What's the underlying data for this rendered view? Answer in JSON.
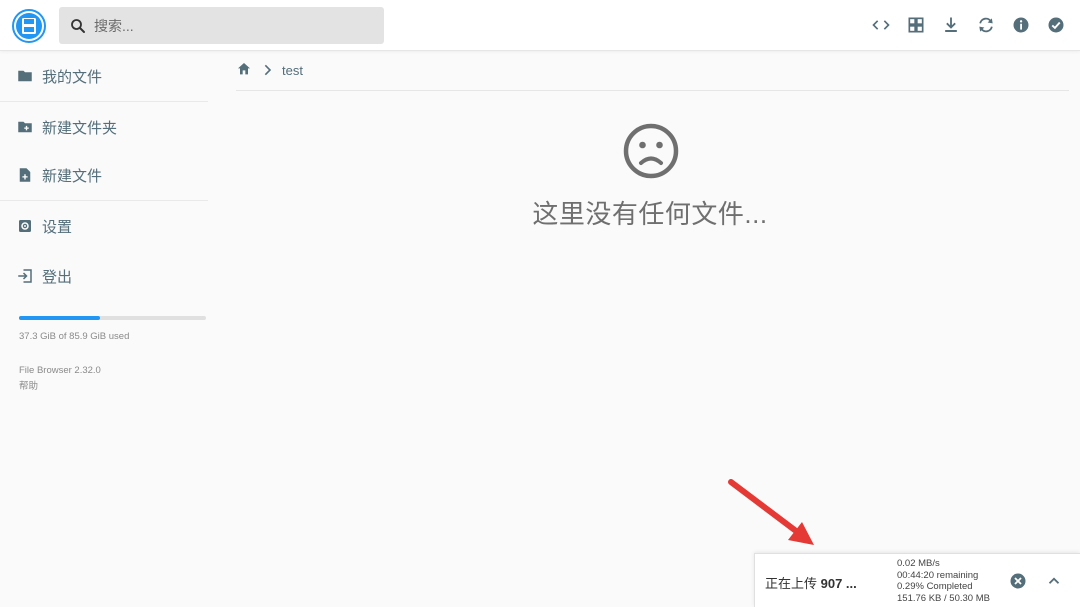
{
  "search": {
    "placeholder": "搜索..."
  },
  "header": {
    "icons": [
      "code-view-icon",
      "grid-view-icon",
      "download-icon",
      "switch-view-icon",
      "info-icon",
      "select-check-icon"
    ]
  },
  "sidebar": {
    "items": [
      {
        "label": "我的文件",
        "icon": "folder-icon"
      },
      {
        "label": "新建文件夹",
        "icon": "create-folder-icon"
      },
      {
        "label": "新建文件",
        "icon": "note-add-icon"
      },
      {
        "label": "设置",
        "icon": "settings-icon"
      },
      {
        "label": "登出",
        "icon": "logout-icon"
      }
    ],
    "storage": {
      "text": "37.3 GiB of 85.9 GiB used",
      "used_fraction": 0.434
    },
    "version": "File Browser 2.32.0",
    "help": "帮助"
  },
  "breadcrumbs": {
    "current": "test"
  },
  "main": {
    "empty_message": "这里没有任何文件..."
  },
  "upload": {
    "title_cn": "正在上传",
    "title_rest": " 907 ...",
    "speed": "0.02 MB/s",
    "remaining": "00:44:20 remaining",
    "completed": "0.29% Completed",
    "size": "151.76 KB / 50.30 MB"
  },
  "colors": {
    "accent": "#2196f3",
    "icon": "#546e7a",
    "annotation": "#e53935"
  }
}
